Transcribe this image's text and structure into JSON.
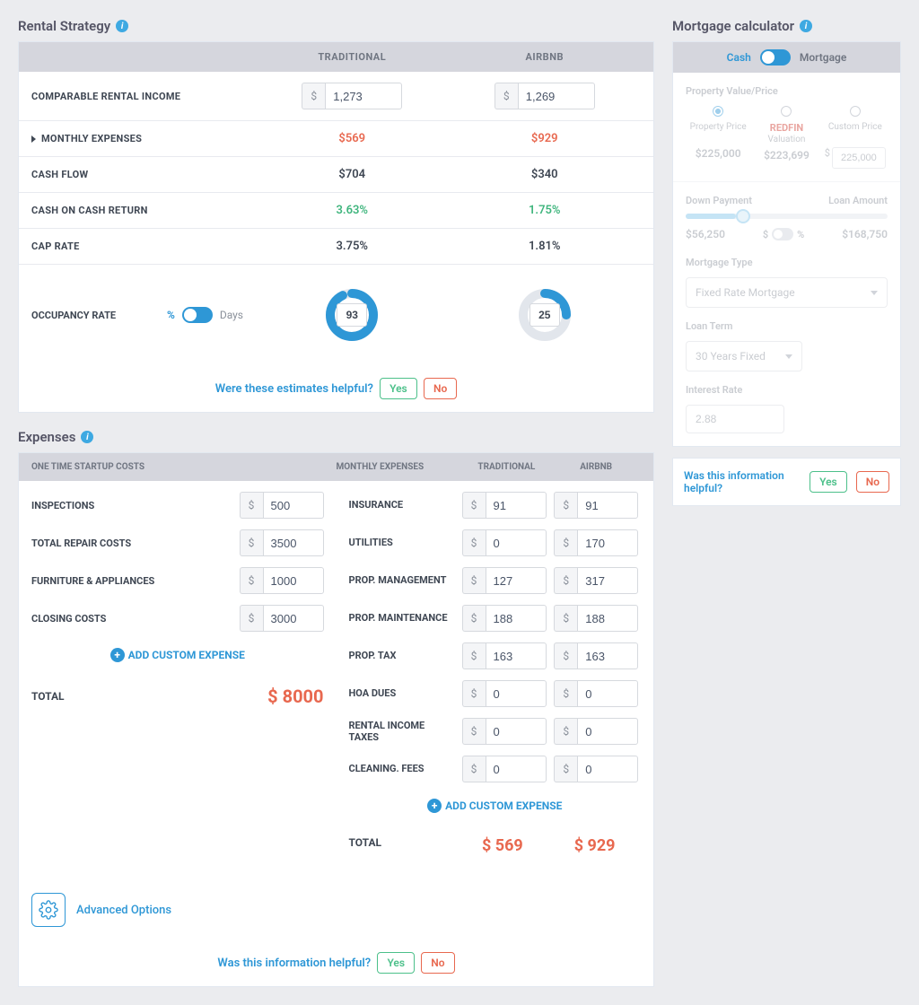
{
  "rental_strategy": {
    "title": "Rental Strategy",
    "col_traditional": "TRADITIONAL",
    "col_airbnb": "AIRBNB",
    "rows": {
      "comparable_income": {
        "label": "COMPARABLE RENTAL INCOME",
        "traditional": "1,273",
        "airbnb": "1,269"
      },
      "monthly_expenses": {
        "label": "MONTHLY EXPENSES",
        "traditional": "$569",
        "airbnb": "$929"
      },
      "cash_flow": {
        "label": "CASH FLOW",
        "traditional": "$704",
        "airbnb": "$340"
      },
      "coc_return": {
        "label": "CASH ON CASH RETURN",
        "traditional": "3.63%",
        "airbnb": "1.75%"
      },
      "cap_rate": {
        "label": "CAP RATE",
        "traditional": "3.75%",
        "airbnb": "1.81%"
      },
      "occupancy": {
        "label": "OCCUPANCY RATE",
        "toggle_left": "%",
        "toggle_right": "Days",
        "traditional": "93",
        "traditional_pct": 93,
        "airbnb": "25",
        "airbnb_pct": 25
      }
    },
    "helpful_prompt": "Were these estimates helpful?",
    "yes": "Yes",
    "no": "No"
  },
  "expenses": {
    "title": "Expenses",
    "header_onetime": "ONE TIME STARTUP COSTS",
    "header_monthly": "MONTHLY EXPENSES",
    "header_traditional": "TRADITIONAL",
    "header_airbnb": "AIRBNB",
    "onetime": {
      "inspections": {
        "label": "INSPECTIONS",
        "value": "500"
      },
      "repair": {
        "label": "TOTAL REPAIR COSTS",
        "value": "3500"
      },
      "furniture": {
        "label": "FURNITURE & APPLIANCES",
        "value": "1000"
      },
      "closing": {
        "label": "CLOSING COSTS",
        "value": "3000"
      }
    },
    "monthly": {
      "insurance": {
        "label": "INSURANCE",
        "traditional": "91",
        "airbnb": "91"
      },
      "utilities": {
        "label": "UTILITIES",
        "traditional": "0",
        "airbnb": "170"
      },
      "management": {
        "label": "PROP. MANAGEMENT",
        "traditional": "127",
        "airbnb": "317"
      },
      "maintenance": {
        "label": "PROP. MAINTENANCE",
        "traditional": "188",
        "airbnb": "188"
      },
      "tax": {
        "label": "PROP. TAX",
        "traditional": "163",
        "airbnb": "163"
      },
      "hoa": {
        "label": "HOA DUES",
        "traditional": "0",
        "airbnb": "0"
      },
      "income_tax": {
        "label": "RENTAL INCOME TAXES",
        "traditional": "0",
        "airbnb": "0"
      },
      "cleaning": {
        "label": "CLEANING. FEES",
        "traditional": "0",
        "airbnb": "0"
      }
    },
    "add_custom": "ADD CUSTOM EXPENSE",
    "total_label": "TOTAL",
    "total_onetime": "$ 8000",
    "total_traditional": "$ 569",
    "total_airbnb": "$ 929",
    "advanced_options": "Advanced Options",
    "helpful_prompt": "Was this information helpful?",
    "yes": "Yes",
    "no": "No"
  },
  "mortgage": {
    "title": "Mortgage calculator",
    "toggle_cash": "Cash",
    "toggle_mortgage": "Mortgage",
    "section_value": "Property Value/Price",
    "prop_price_label": "Property Price",
    "prop_price_val": "$225,000",
    "redfin_label1": "REDFIN",
    "redfin_label2": "Valuation",
    "redfin_val": "$223,699",
    "custom_label": "Custom Price",
    "custom_val": "225,000",
    "down_payment": "Down Payment",
    "loan_amount": "Loan Amount",
    "dp_val": "$56,250",
    "dp_unit_dollar": "$",
    "dp_unit_pct": "%",
    "loan_val": "$168,750",
    "mortgage_type_label": "Mortgage Type",
    "mortgage_type_val": "Fixed Rate Mortgage",
    "loan_term_label": "Loan Term",
    "loan_term_val": "30 Years Fixed",
    "interest_label": "Interest Rate",
    "interest_val": "2.88",
    "helpful_prompt": "Was this information helpful?",
    "yes": "Yes",
    "no": "No"
  }
}
